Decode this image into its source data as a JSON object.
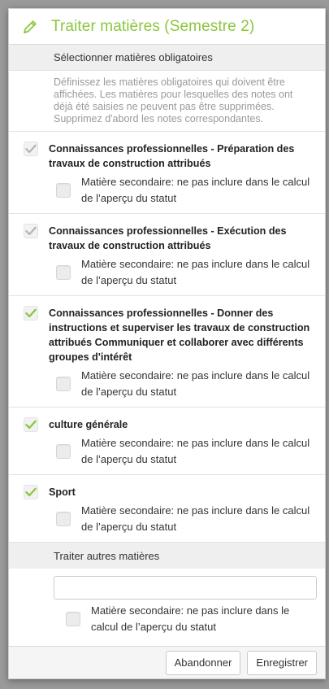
{
  "dialog": {
    "title": "Traiter matières (Semestre 2)",
    "accent_color": "#8cc63f",
    "icon": "pencil-icon"
  },
  "mandatory": {
    "heading": "Sélectionner matières obligatoires",
    "description": "Définissez les matières obligatoires qui doivent être affichées. Les matières pour lesquelles des notes ont déjà été saisies ne peuvent pas être supprimées. Supprimez d'abord les notes correspondantes.",
    "subjects": [
      {
        "name": "Connaissances professionnelles - Préparation des travaux de construction attribués",
        "checked": true,
        "check_color": "#b5b5b5",
        "secondary_label": "Matière secondaire: ne pas inclure dans le calcul de l’aperçu du statut",
        "secondary_checked": false
      },
      {
        "name": "Connaissances professionnelles - Exécution des travaux de construction attribués",
        "checked": true,
        "check_color": "#b5b5b5",
        "secondary_label": "Matière secondaire: ne pas inclure dans le calcul de l’aperçu du statut",
        "secondary_checked": false
      },
      {
        "name": "Connaissances professionnelles - Donner des instructions et superviser les travaux de construction attribués Communiquer et collaborer avec différents groupes d'intérêt",
        "checked": true,
        "check_color": "#8cc63f",
        "secondary_label": "Matière secondaire: ne pas inclure dans le calcul de l’aperçu du statut",
        "secondary_checked": false
      },
      {
        "name": "culture générale",
        "checked": true,
        "check_color": "#8cc63f",
        "secondary_label": "Matière secondaire: ne pas inclure dans le calcul de l’aperçu du statut",
        "secondary_checked": false
      },
      {
        "name": "Sport",
        "checked": true,
        "check_color": "#8cc63f",
        "secondary_label": "Matière secondaire: ne pas inclure dans le calcul de l’aperçu du statut",
        "secondary_checked": false
      }
    ]
  },
  "other": {
    "heading": "Traiter autres matières",
    "input_value": "",
    "input_placeholder": "",
    "secondary_label": "Matière secondaire: ne pas inclure dans le calcul de l’aperçu du statut",
    "secondary_checked": false
  },
  "footer": {
    "cancel_label": "Abandonner",
    "save_label": "Enregistrer"
  }
}
